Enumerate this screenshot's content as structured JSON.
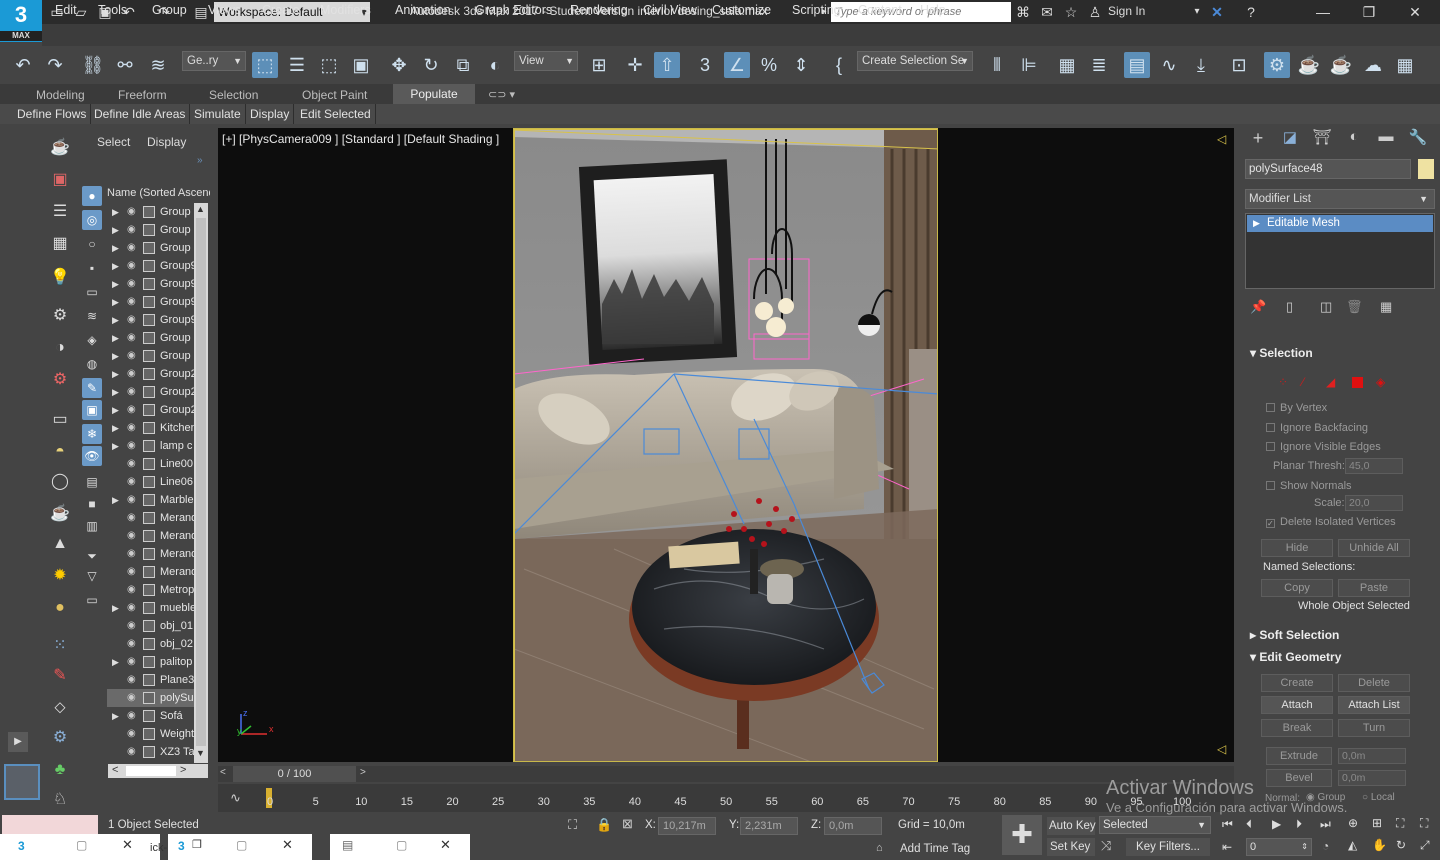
{
  "app": {
    "logo_main": "3",
    "logo_sub": "MAX",
    "workspace": "Workspace: Default",
    "title": "Autodesk 3ds Max 2017 - Student Version    interior desing_sala.max",
    "search_placeholder": "Type a keyword or phrase",
    "signin": "Sign In"
  },
  "menus": [
    "Edit",
    "Tools",
    "Group",
    "Views",
    "Create",
    "Modifiers",
    "Animation",
    "Graph Editors",
    "Rendering",
    "Civil View",
    "Customize",
    "Scripting",
    "Content",
    "Help"
  ],
  "toolbar": {
    "filter_combo": "Ge..ry",
    "refcoord_combo": "View",
    "selection_set": "Create Selection Se"
  },
  "ribbon": {
    "tabs": [
      "Modeling",
      "Freeform",
      "Selection",
      "Object Paint",
      "Populate"
    ],
    "active_tab": "Populate",
    "subtabs": [
      "Define Flows",
      "Define Idle Areas",
      "Simulate",
      "Display",
      "Edit Selected"
    ]
  },
  "explorer": {
    "tabs": [
      "Select",
      "Display"
    ],
    "column_header": "Name (Sorted Ascending)",
    "rows": [
      {
        "name": "Group",
        "expand": true
      },
      {
        "name": "Group",
        "expand": true
      },
      {
        "name": "Group",
        "expand": true
      },
      {
        "name": "Group9",
        "expand": true
      },
      {
        "name": "Group9",
        "expand": true
      },
      {
        "name": "Group9",
        "expand": true
      },
      {
        "name": "Group9",
        "expand": true
      },
      {
        "name": "Group",
        "expand": true
      },
      {
        "name": "Group",
        "expand": true
      },
      {
        "name": "Group2",
        "expand": true
      },
      {
        "name": "Group2",
        "expand": true
      },
      {
        "name": "Group2",
        "expand": true
      },
      {
        "name": "Kitchen",
        "expand": true
      },
      {
        "name": "lamp c",
        "expand": true
      },
      {
        "name": "Line00",
        "expand": false
      },
      {
        "name": "Line06",
        "expand": false
      },
      {
        "name": "Marble",
        "expand": true
      },
      {
        "name": "Merand",
        "expand": false
      },
      {
        "name": "Merand",
        "expand": false
      },
      {
        "name": "Merand",
        "expand": false
      },
      {
        "name": "Merand",
        "expand": false
      },
      {
        "name": "Metrop",
        "expand": false
      },
      {
        "name": "mueble",
        "expand": true
      },
      {
        "name": "obj_01",
        "expand": false
      },
      {
        "name": "obj_02",
        "expand": false
      },
      {
        "name": "palitop",
        "expand": true
      },
      {
        "name": "Plane3",
        "expand": false
      },
      {
        "name": "polySu",
        "expand": false,
        "selected": true
      },
      {
        "name": "Sofá",
        "expand": true
      },
      {
        "name": "Weight",
        "expand": false
      },
      {
        "name": "XZ3 Ta",
        "expand": false
      }
    ]
  },
  "viewport": {
    "label": "[+] [PhysCamera009 ] [Standard ] [Default Shading ]",
    "axis_x": "x",
    "axis_y": "y",
    "axis_z": "z"
  },
  "timeline": {
    "slider_label": "0 / 100",
    "ticks": [
      "0",
      "5",
      "10",
      "15",
      "20",
      "25",
      "30",
      "35",
      "40",
      "45",
      "50",
      "55",
      "60",
      "65",
      "70",
      "75",
      "80",
      "85",
      "90",
      "95",
      "100"
    ]
  },
  "command_panel": {
    "object_name": "polySurface48",
    "object_color": "#efe2a2",
    "modifier_list": "Modifier List",
    "stack_item": "Editable Mesh",
    "selection": {
      "header": "Selection",
      "by_vertex": "By Vertex",
      "ignore_backfacing": "Ignore Backfacing",
      "ignore_visible_edges": "Ignore Visible Edges",
      "planar_thresh_label": "Planar Thresh:",
      "planar_thresh_value": "45,0",
      "show_normals": "Show Normals",
      "scale_label": "Scale:",
      "scale_value": "20,0",
      "delete_isolated": "Delete Isolated Vertices",
      "hide": "Hide",
      "unhide_all": "Unhide All",
      "named_selections": "Named Selections:",
      "copy": "Copy",
      "paste": "Paste",
      "whole_object": "Whole Object Selected"
    },
    "soft_selection": "Soft Selection",
    "edit_geometry": {
      "header": "Edit Geometry",
      "create": "Create",
      "delete": "Delete",
      "attach": "Attach",
      "attach_list": "Attach List",
      "break": "Break",
      "turn": "Turn",
      "extrude": "Extrude",
      "extrude_value": "0,0m",
      "bevel": "Bevel",
      "bevel_value": "0,0m",
      "normal": "Normal:",
      "group": "Group",
      "local": "Local"
    }
  },
  "status": {
    "objects_selected": "1 Object Selected",
    "x_label": "X:",
    "x_value": "10,217m",
    "y_label": "Y:",
    "y_value": "2,231m",
    "z_label": "Z:",
    "z_value": "0,0m",
    "grid": "Grid = 10,0m",
    "add_time_tag": "Add Time Tag",
    "auto_key": "Auto Key",
    "set_key": "Set Key",
    "selected_combo": "Selected",
    "key_filters": "Key Filters...",
    "frame": "0",
    "task_fragment": "ick-"
  },
  "watermark": {
    "line1": "Activar Windows",
    "line2": "Ve a Configuración para activar Windows."
  }
}
